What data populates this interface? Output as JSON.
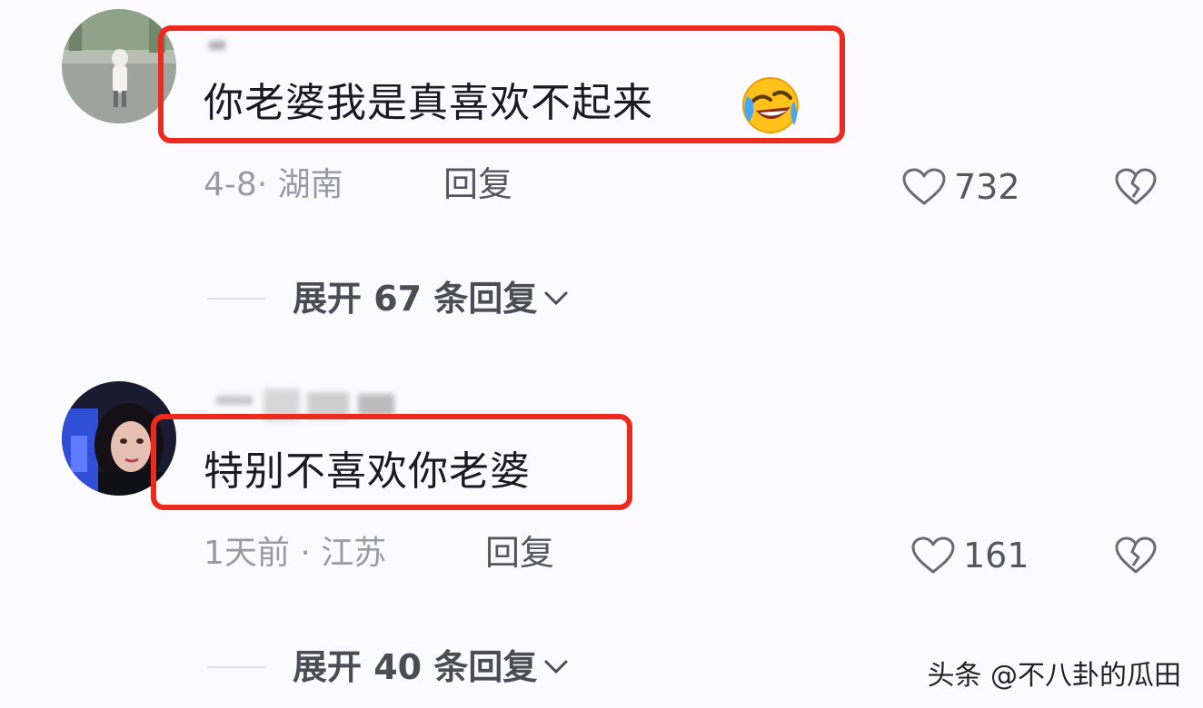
{
  "comments": [
    {
      "text": "你老婆我是真喜欢不起来",
      "emoji": "rofl-emoji",
      "date_location": "4-8· 湖南",
      "reply_label": "回复",
      "likes": "732",
      "expand_label": "展开 67 条回复"
    },
    {
      "text": "特别不喜欢你老婆",
      "date_location": "1天前 · 江苏",
      "reply_label": "回复",
      "likes": "161",
      "expand_label": "展开 40 条回复"
    }
  ],
  "icons": {
    "like": "heart-outline-icon",
    "dislike": "broken-heart-icon",
    "expand": "chevron-down-icon"
  },
  "colors": {
    "highlight_border": "#ee2a1f",
    "background": "#fbfbfd"
  },
  "watermark": "头条 @不八卦的瓜田"
}
